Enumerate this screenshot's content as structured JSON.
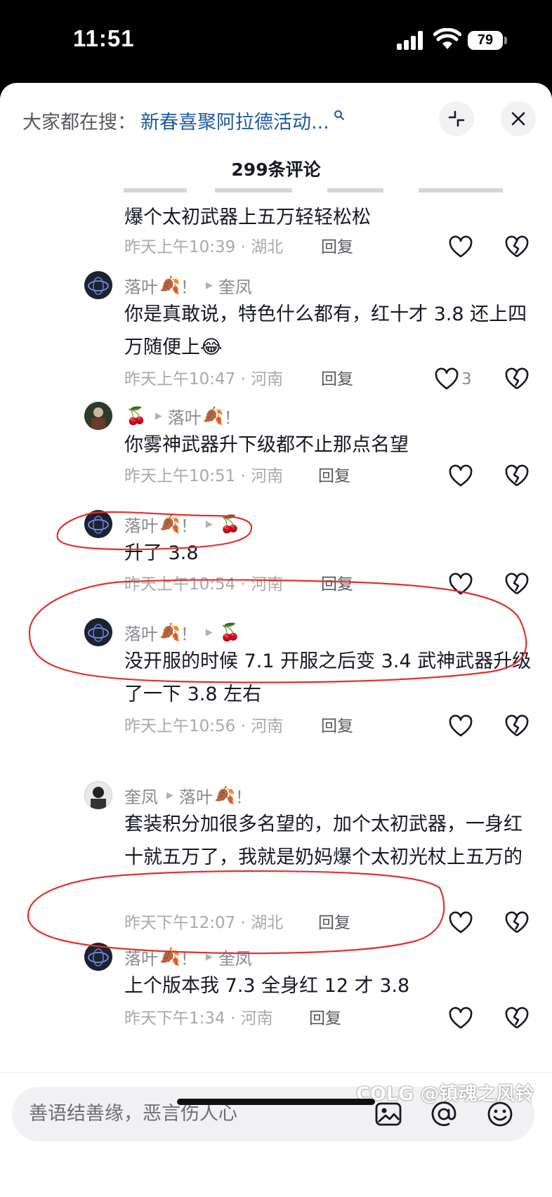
{
  "status_bar": {
    "time": "11:51",
    "battery": "79"
  },
  "search": {
    "prefix": "大家都在搜：",
    "link_text": "新春喜聚阿拉德活动..."
  },
  "comment_count_title": "299条评论",
  "comments": [
    {
      "text": "爆个太初武器上五万轻轻松松",
      "info": "昨天上午10:39 · 湖北",
      "reply": "回复"
    },
    {
      "user": "落叶",
      "user_emoji": "🍂",
      "user_suffix": "！",
      "to_user": "奎凤",
      "to_emoji": "",
      "text": "你是真敢说，特色什么都有，红十才 3.8 还上四万随便上😂",
      "info": "昨天上午10:47 · 河南",
      "reply": "回复",
      "likes": "3"
    },
    {
      "user": "",
      "user_emoji": "🍒",
      "user_suffix": "",
      "to_user": "落叶",
      "to_emoji": "🍂",
      "to_suffix": "！",
      "text": "你雾神武器升下级都不止那点名望",
      "info": "昨天上午10:51 · 河南",
      "reply": "回复"
    },
    {
      "user": "落叶",
      "user_emoji": "🍂",
      "user_suffix": "！",
      "to_user": "",
      "to_emoji": "🍒",
      "text": "升了 3.8",
      "info": "昨天上午10:54 · 河南",
      "reply": "回复"
    },
    {
      "user": "落叶",
      "user_emoji": "🍂",
      "user_suffix": "！",
      "to_user": "",
      "to_emoji": "🍒",
      "text": "没开服的时候 7.1 开服之后变 3.4 武神武器升级了一下 3.8 左右",
      "info": "昨天上午10:56 · 河南",
      "reply": "回复"
    },
    {
      "user": "奎凤",
      "user_emoji": "",
      "user_suffix": "",
      "to_user": "落叶",
      "to_emoji": "🍂",
      "to_suffix": "！",
      "text": "套装积分加很多名望的，加个太初武器，一身红十就五万了，我就是奶妈爆个太初光杖上五万的",
      "info": "昨天下午12:07 · 湖北",
      "reply": "回复"
    },
    {
      "user": "落叶",
      "user_emoji": "🍂",
      "user_suffix": "！",
      "to_user": "奎凤",
      "to_emoji": "",
      "text": "上个版本我 7.3 全身红 12 才 3.8",
      "info": "昨天下午1:34 · 河南",
      "reply": "回复"
    }
  ],
  "input": {
    "placeholder": "善语结善缘，恶言伤人心"
  },
  "icons": [
    "search-icon",
    "collapse-icon",
    "close-icon",
    "heart-icon",
    "broken-heart-icon",
    "image-icon",
    "at-icon",
    "emoji-icon"
  ],
  "watermark": "COLG @镇魂之风铃",
  "colors": {
    "link": "#1c5b9e",
    "annotation": "#e0312b",
    "meta": "#8a8b91"
  }
}
